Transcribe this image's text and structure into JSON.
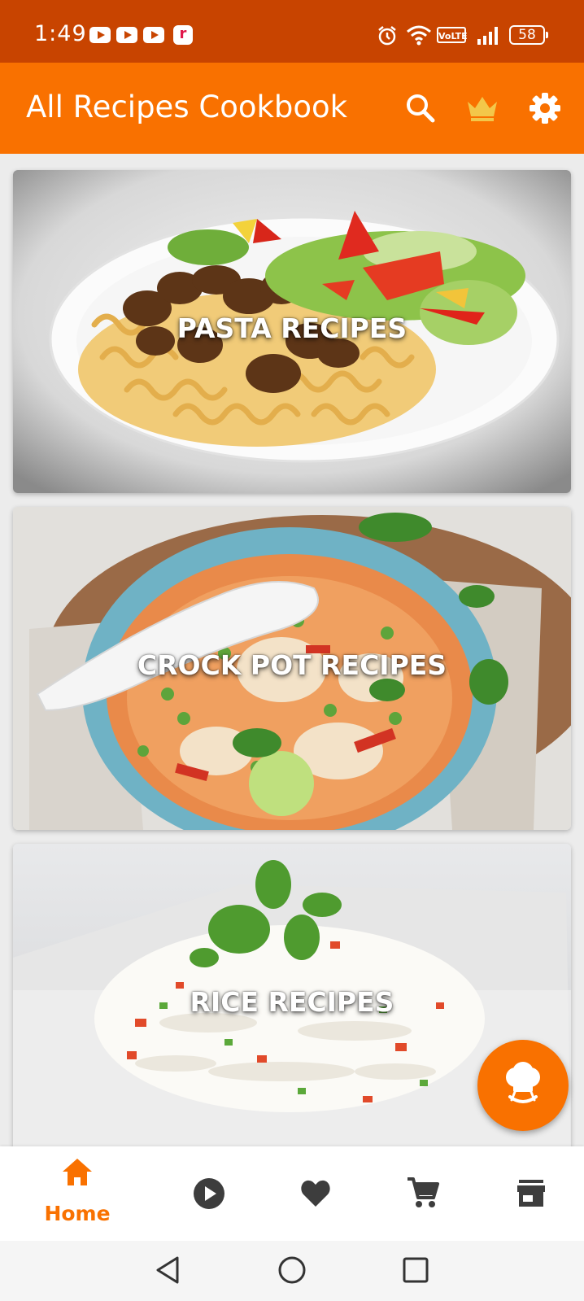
{
  "status_bar": {
    "time": "1:49",
    "notification_icons": [
      "youtube-icon",
      "youtube-icon",
      "youtube-icon",
      "r-app-icon"
    ],
    "r_label": "r",
    "volte": "VoLTE",
    "battery": "58",
    "right_icons": [
      "alarm-icon",
      "wifi-icon",
      "volte-icon",
      "signal-icon",
      "battery-icon"
    ]
  },
  "app_bar": {
    "title": "All Recipes Cookbook",
    "actions": [
      "search-icon",
      "crown-icon",
      "settings-icon"
    ],
    "colors": {
      "primary": "#f97100",
      "status": "#c84400",
      "crown": "#f3c74a"
    }
  },
  "categories": [
    {
      "label": "PASTA RECIPES"
    },
    {
      "label": "CROCK POT RECIPES"
    },
    {
      "label": "RICE RECIPES"
    }
  ],
  "fab": {
    "icon": "chef-hat-icon"
  },
  "bottom_nav": {
    "items": [
      {
        "label": "Home",
        "icon": "home-icon",
        "active": true
      },
      {
        "label": "",
        "icon": "play-circle-icon",
        "active": false
      },
      {
        "label": "",
        "icon": "heart-icon",
        "active": false
      },
      {
        "label": "",
        "icon": "cart-icon",
        "active": false
      },
      {
        "label": "",
        "icon": "store-icon",
        "active": false
      }
    ]
  },
  "system_nav": [
    "back-icon",
    "home-circle-icon",
    "recents-icon"
  ]
}
